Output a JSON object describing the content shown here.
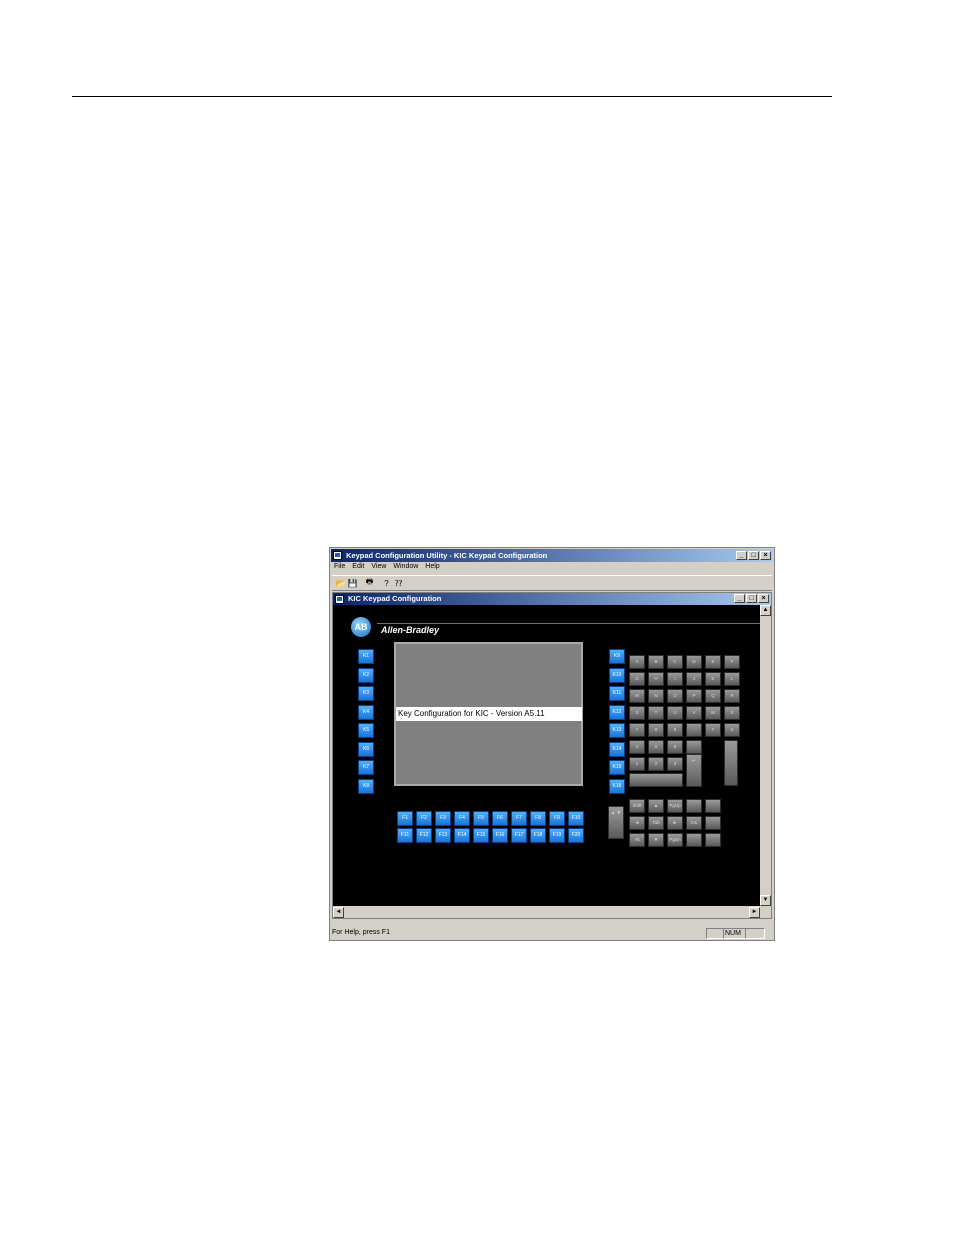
{
  "app": {
    "title": "Keypad Configuration Utility - KIC Keypad Configuration",
    "menu": [
      "File",
      "Edit",
      "View",
      "Window",
      "Help"
    ],
    "toolbar_icons": [
      "open-icon",
      "save-icon",
      "print-icon",
      "help-icon",
      "context-help-icon"
    ],
    "window_buttons": [
      "_",
      "□",
      "×"
    ]
  },
  "child": {
    "title": "KIC Keypad Configuration",
    "logo": "AB",
    "brand": "Allen-Bradley",
    "screen_label": "Key Configuration for KIC - Version A5.11",
    "left_keys": [
      "K1",
      "K2",
      "K3",
      "K4",
      "K5",
      "K6",
      "K7",
      "K8"
    ],
    "mid_keys": [
      "K9",
      "K10",
      "K11",
      "K12",
      "K13",
      "K14",
      "K15",
      "K16"
    ],
    "f_row1": [
      "F1",
      "F2",
      "F3",
      "F4",
      "F5",
      "F6",
      "F7",
      "F8",
      "F9",
      "F10"
    ],
    "f_row2": [
      "F11",
      "F12",
      "F13",
      "F14",
      "F15",
      "F16",
      "F17",
      "F18",
      "F19",
      "F20"
    ],
    "alpha_rows": [
      [
        "A",
        "B",
        "C",
        "D",
        "E",
        "F"
      ],
      [
        "G",
        "H",
        "I",
        "J",
        "K",
        "L"
      ],
      [
        "M",
        "N",
        "O",
        "P",
        "Q",
        "R"
      ],
      [
        "S",
        "T",
        "U",
        "V",
        "W",
        "X"
      ],
      [
        "7",
        "8",
        "9",
        "-",
        "Y",
        "Z"
      ]
    ],
    "num_rows": [
      [
        "4",
        "5",
        "6",
        "."
      ],
      [
        "1",
        "2",
        "3"
      ]
    ],
    "nav_rows": [
      [
        "Shift",
        "▲",
        "PgUp",
        "",
        ""
      ],
      [
        "◄",
        "Tab",
        "►",
        "Ins",
        ""
      ],
      [
        "Alt",
        "▼",
        "PgDn",
        "",
        ""
      ]
    ]
  },
  "status": {
    "text": "For Help, press F1",
    "num": "NUM"
  }
}
